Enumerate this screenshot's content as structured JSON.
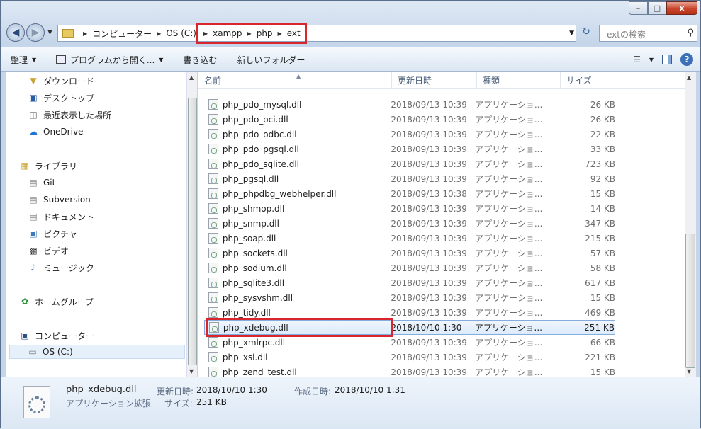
{
  "window": {
    "min_glyph": "–",
    "max_glyph": "□",
    "close_glyph": "x"
  },
  "address": {
    "crumbs": [
      "コンピューター",
      "OS (C:)"
    ],
    "highlighted_crumbs": [
      "xampp",
      "php",
      "ext"
    ]
  },
  "search": {
    "placeholder": "extの検索"
  },
  "toolbar": {
    "organize": "整理",
    "open_with": "プログラムから開く...",
    "burn": "書き込む",
    "new_folder": "新しいフォルダー"
  },
  "nav": {
    "downloads": "ダウンロード",
    "desktop": "デスクトップ",
    "recent": "最近表示した場所",
    "onedrive": "OneDrive",
    "libraries": "ライブラリ",
    "git": "Git",
    "subversion": "Subversion",
    "documents": "ドキュメント",
    "pictures": "ピクチャ",
    "videos": "ビデオ",
    "music": "ミュージック",
    "homegroup": "ホームグループ",
    "computer": "コンピューター",
    "os_c": "OS (C:)"
  },
  "columns": {
    "name": "名前",
    "date": "更新日時",
    "type": "種類",
    "size": "サイズ"
  },
  "files": [
    {
      "name": "php_pdo_mysql.dll",
      "date": "2018/09/13 10:39",
      "type": "アプリケーショ...",
      "size": "26 KB"
    },
    {
      "name": "php_pdo_oci.dll",
      "date": "2018/09/13 10:39",
      "type": "アプリケーショ...",
      "size": "26 KB"
    },
    {
      "name": "php_pdo_odbc.dll",
      "date": "2018/09/13 10:39",
      "type": "アプリケーショ...",
      "size": "22 KB"
    },
    {
      "name": "php_pdo_pgsql.dll",
      "date": "2018/09/13 10:39",
      "type": "アプリケーショ...",
      "size": "33 KB"
    },
    {
      "name": "php_pdo_sqlite.dll",
      "date": "2018/09/13 10:39",
      "type": "アプリケーショ...",
      "size": "723 KB"
    },
    {
      "name": "php_pgsql.dll",
      "date": "2018/09/13 10:39",
      "type": "アプリケーショ...",
      "size": "92 KB"
    },
    {
      "name": "php_phpdbg_webhelper.dll",
      "date": "2018/09/13 10:38",
      "type": "アプリケーショ...",
      "size": "15 KB"
    },
    {
      "name": "php_shmop.dll",
      "date": "2018/09/13 10:39",
      "type": "アプリケーショ...",
      "size": "14 KB"
    },
    {
      "name": "php_snmp.dll",
      "date": "2018/09/13 10:39",
      "type": "アプリケーショ...",
      "size": "347 KB"
    },
    {
      "name": "php_soap.dll",
      "date": "2018/09/13 10:39",
      "type": "アプリケーショ...",
      "size": "215 KB"
    },
    {
      "name": "php_sockets.dll",
      "date": "2018/09/13 10:39",
      "type": "アプリケーショ...",
      "size": "57 KB"
    },
    {
      "name": "php_sodium.dll",
      "date": "2018/09/13 10:39",
      "type": "アプリケーショ...",
      "size": "58 KB"
    },
    {
      "name": "php_sqlite3.dll",
      "date": "2018/09/13 10:39",
      "type": "アプリケーショ...",
      "size": "617 KB"
    },
    {
      "name": "php_sysvshm.dll",
      "date": "2018/09/13 10:39",
      "type": "アプリケーショ...",
      "size": "15 KB"
    },
    {
      "name": "php_tidy.dll",
      "date": "2018/09/13 10:39",
      "type": "アプリケーショ...",
      "size": "469 KB"
    },
    {
      "name": "php_xdebug.dll",
      "date": "2018/10/10 1:30",
      "type": "アプリケーショ...",
      "size": "251 KB"
    },
    {
      "name": "php_xmlrpc.dll",
      "date": "2018/09/13 10:39",
      "type": "アプリケーショ...",
      "size": "66 KB"
    },
    {
      "name": "php_xsl.dll",
      "date": "2018/09/13 10:39",
      "type": "アプリケーショ...",
      "size": "221 KB"
    },
    {
      "name": "php_zend_test.dll",
      "date": "2018/09/13 10:39",
      "type": "アプリケーショ...",
      "size": "15 KB"
    }
  ],
  "details": {
    "filename": "php_xdebug.dll",
    "modified_label": "更新日時:",
    "modified_value": "2018/10/10 1:30",
    "created_label": "作成日時:",
    "created_value": "2018/10/10 1:31",
    "type": "アプリケーション拡張",
    "size_label": "サイズ:",
    "size_value": "251 KB"
  }
}
